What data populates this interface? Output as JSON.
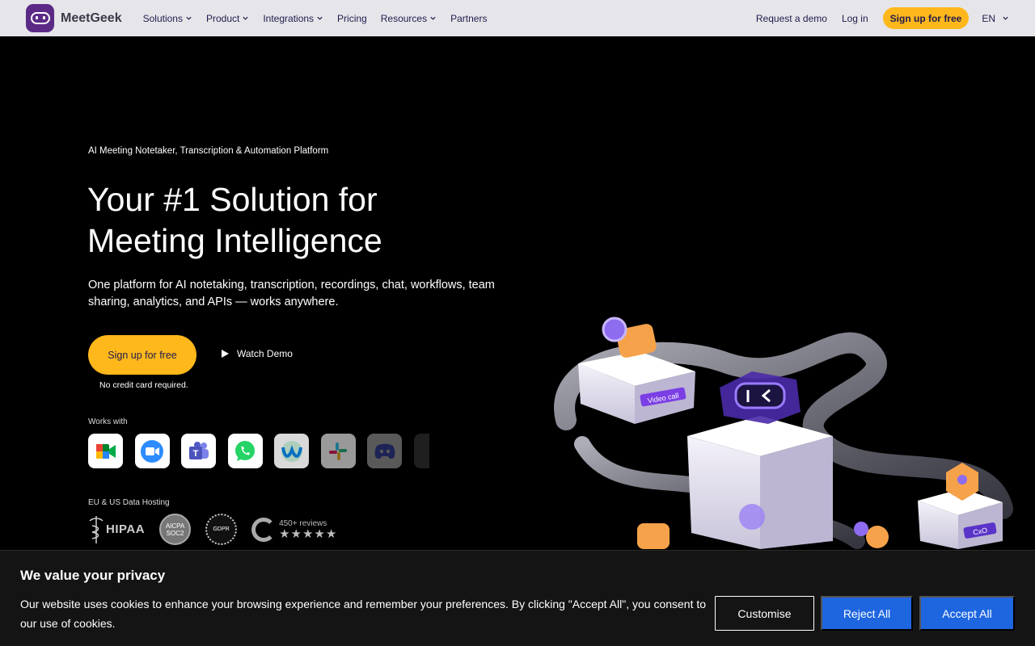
{
  "nav": {
    "brand": "MeetGeek",
    "items": [
      {
        "label": "Solutions",
        "dropdown": true
      },
      {
        "label": "Product",
        "dropdown": true
      },
      {
        "label": "Integrations",
        "dropdown": true
      },
      {
        "label": "Pricing",
        "dropdown": false
      },
      {
        "label": "Resources",
        "dropdown": true
      },
      {
        "label": "Partners",
        "dropdown": false
      }
    ],
    "request_demo": "Request a demo",
    "login": "Log in",
    "signup": "Sign up for free",
    "language": "EN"
  },
  "hero": {
    "eyebrow": "AI Meeting Notetaker, Transcription & Automation Platform",
    "headline_line1": "Your #1 Solution for",
    "headline_line2": "Meeting Intelligence",
    "subtext": "One platform for AI notetaking, transcription, recordings, chat, workflows, team sharing, analytics, and APIs — works anywhere.",
    "cta": "Sign up for free",
    "watch_demo": "Watch Demo",
    "no_card": "No credit card required.",
    "works_with": "Works with",
    "apps": [
      "google-meet-icon",
      "zoom-icon",
      "microsoft-teams-icon",
      "whatsapp-icon",
      "webex-icon",
      "slack-icon",
      "discord-icon",
      "more-app-icon"
    ],
    "hosting": "EU & US Data Hosting",
    "badges": {
      "hipaa": "HIPAA",
      "aicpa_top": "AICPA",
      "aicpa_bottom": "SOC2",
      "gdpr": "GDPR",
      "reviews": "450+ reviews",
      "stars": "★★★★★"
    },
    "illustration_labels": {
      "video_call": "Video call",
      "cxo": "CxO"
    }
  },
  "cookie": {
    "title": "We value your privacy",
    "text": "Our website uses cookies to enhance your browsing experience and remember your preferences. By clicking \"Accept All\", you consent to our use of cookies.",
    "customise": "Customise",
    "reject": "Reject All",
    "accept": "Accept All"
  },
  "colors": {
    "accent": "#ffb81c",
    "brand": "#5b2a86",
    "cookie_button": "#1e66e0",
    "nav_bg": "#e6e6ea"
  }
}
